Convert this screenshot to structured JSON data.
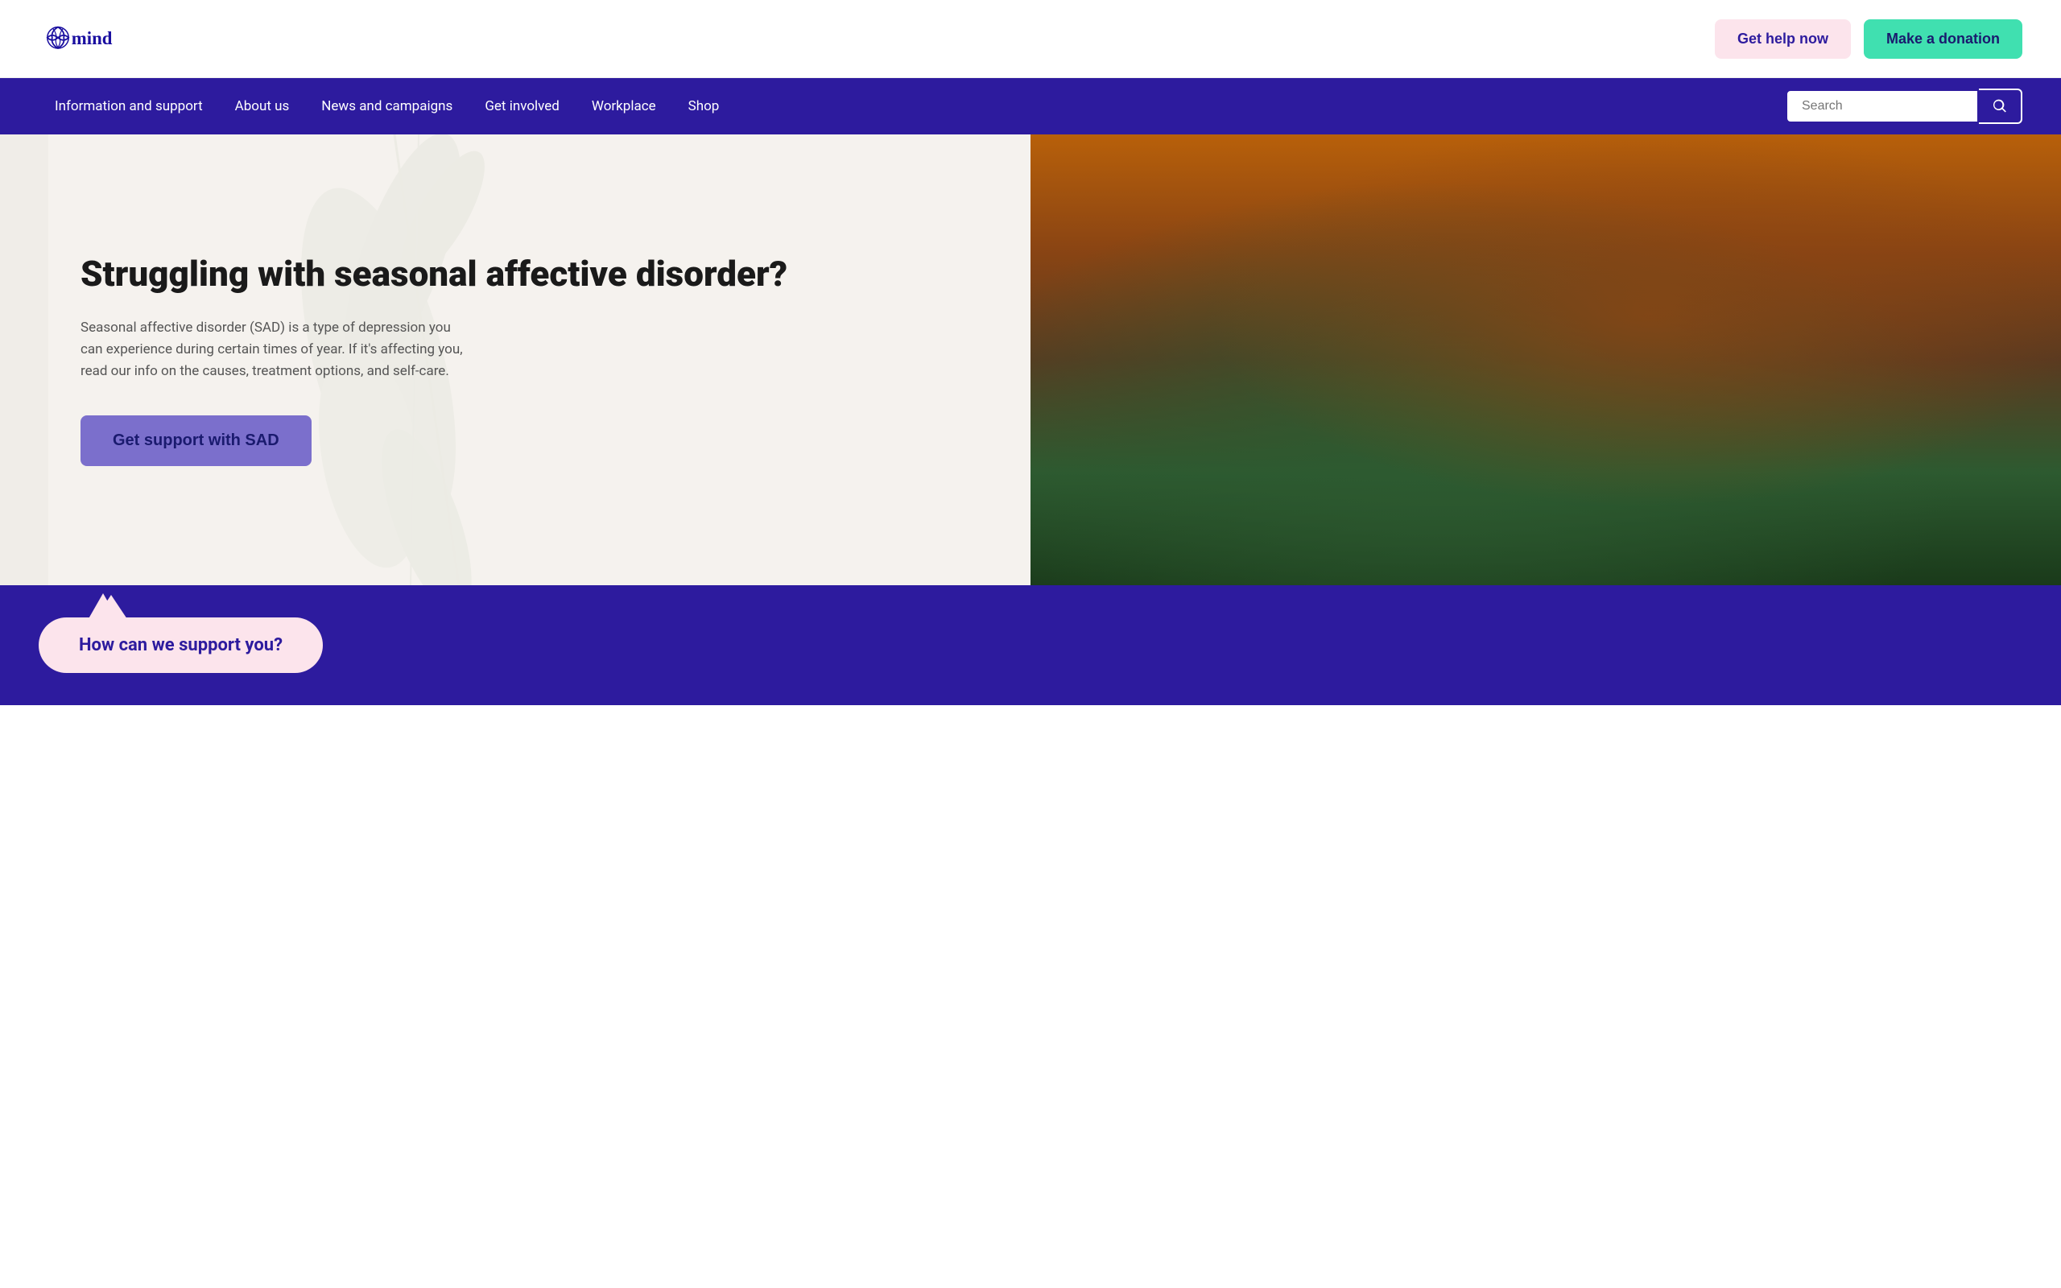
{
  "header": {
    "logo_text": "mind",
    "btn_get_help_label": "Get help now",
    "btn_donation_label": "Make a donation"
  },
  "navbar": {
    "links": [
      {
        "label": "Information and support",
        "id": "info-support"
      },
      {
        "label": "About us",
        "id": "about-us"
      },
      {
        "label": "News and campaigns",
        "id": "news-campaigns"
      },
      {
        "label": "Get involved",
        "id": "get-involved"
      },
      {
        "label": "Workplace",
        "id": "workplace"
      },
      {
        "label": "Shop",
        "id": "shop"
      }
    ],
    "search_placeholder": "Search"
  },
  "hero": {
    "title": "Struggling with seasonal affective disorder?",
    "description": "Seasonal affective disorder (SAD) is a type of depression you can experience during certain times of year. If it's affecting you, read our info on the causes, treatment options, and self-care.",
    "cta_label": "Get support with SAD"
  },
  "bottom": {
    "support_question": "How can we support you?"
  }
}
